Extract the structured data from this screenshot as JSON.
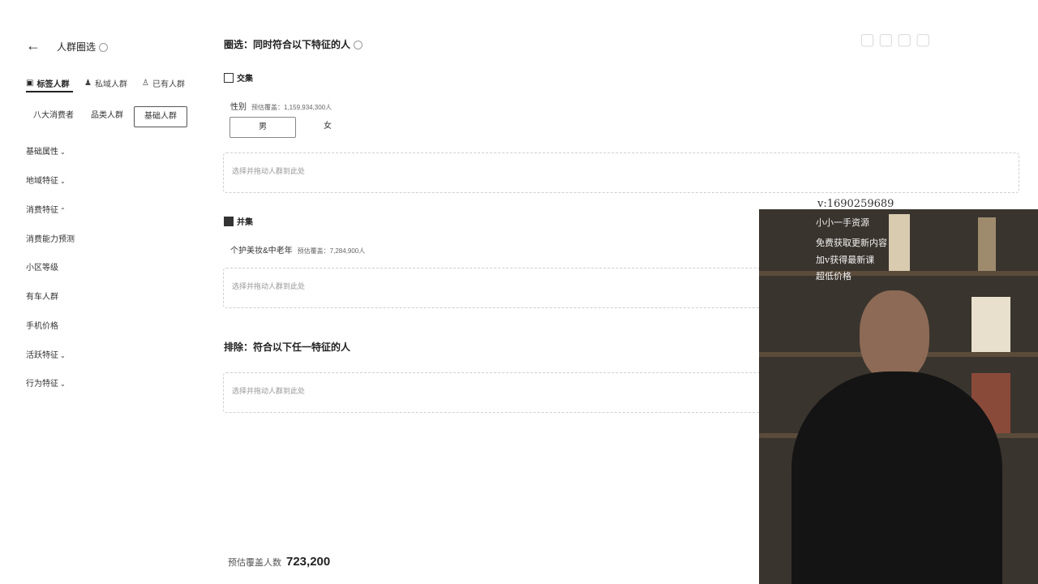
{
  "sidebar": {
    "title": "人群圈选",
    "tabs": [
      {
        "label": "标签人群",
        "icon": "tag-icon"
      },
      {
        "label": "私域人群",
        "icon": "group-icon"
      },
      {
        "label": "已有人群",
        "icon": "person-icon"
      }
    ],
    "sub_tabs": [
      "八大消费者",
      "品类人群",
      "基础人群"
    ],
    "categories": [
      {
        "label": "基础属性",
        "chev": "⌄"
      },
      {
        "label": "地域特征",
        "chev": "⌄"
      },
      {
        "label": "消费特征",
        "chev": "⌃"
      },
      {
        "label": "消费能力预测",
        "chev": ""
      },
      {
        "label": "小区等级",
        "chev": ""
      },
      {
        "label": "有车人群",
        "chev": ""
      },
      {
        "label": "手机价格",
        "chev": ""
      },
      {
        "label": "活跃特征",
        "chev": "⌄"
      },
      {
        "label": "行为特征",
        "chev": "⌄"
      }
    ]
  },
  "main": {
    "title": "圈选：同时符合以下特征的人",
    "intersection": {
      "label": "交集",
      "field_label": "性别",
      "field_est": "预估覆盖：1,159,934,300人",
      "options": [
        "男",
        "女"
      ],
      "placeholder": "选择并拖动人群到此处"
    },
    "union": {
      "label": "并集",
      "field_label": "个护美妆&中老年",
      "field_est": "预估覆盖：7,284,900人",
      "placeholder": "选择并拖动人群到此处"
    },
    "exclude": {
      "title": "排除：符合以下任一特征的人",
      "placeholder": "选择并拖动人群到此处"
    },
    "footer": {
      "label": "预估覆盖人数",
      "value": "723,200"
    }
  },
  "overlay": {
    "contact": "v:1690259689",
    "video_lines": [
      "小小一手资源",
      "免费获取更新内容",
      "加v获得最新课",
      "超低价格"
    ]
  }
}
